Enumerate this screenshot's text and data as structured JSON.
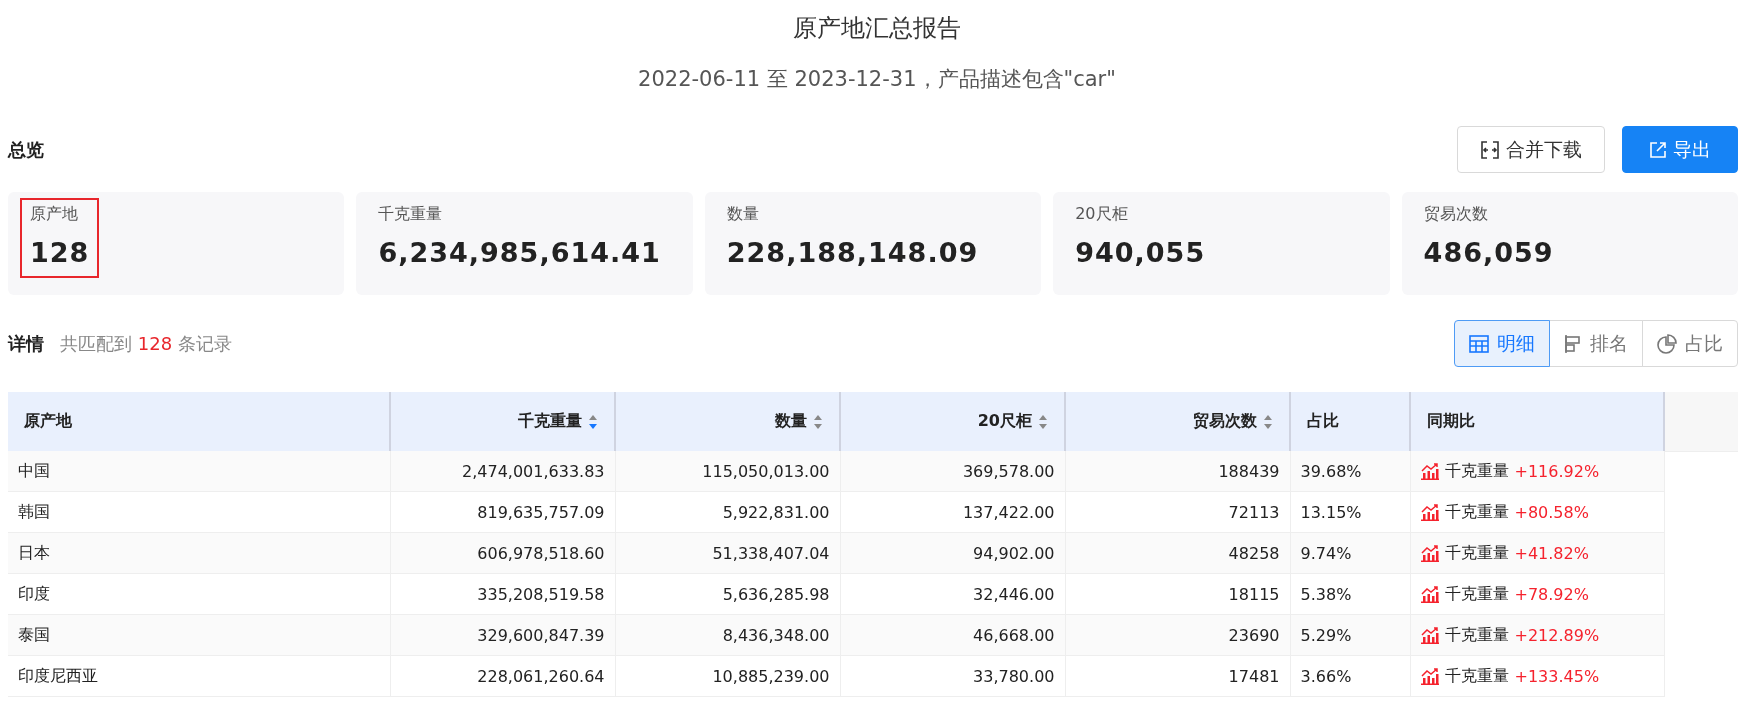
{
  "report": {
    "title": "原产地汇总报告",
    "subtitle": "2022-06-11 至 2023-12-31，产品描述包含\"car\""
  },
  "overview": {
    "heading": "总览",
    "buttons": [
      {
        "label": "合并下载",
        "kind": "merge"
      },
      {
        "label": "导出",
        "kind": "export"
      }
    ],
    "cards": [
      {
        "label": "原产地",
        "value": "128",
        "selected": true
      },
      {
        "label": "千克重量",
        "value": "6,234,985,614.41",
        "selected": false
      },
      {
        "label": "数量",
        "value": "228,188,148.09",
        "selected": false
      },
      {
        "label": "20尺柜",
        "value": "940,055",
        "selected": false
      },
      {
        "label": "贸易次数",
        "value": "486,059",
        "selected": false
      }
    ]
  },
  "details": {
    "heading": "详情",
    "summary_prefix": "共匹配到",
    "count": "128",
    "summary_suffix": "条记录",
    "views": [
      {
        "label": "明细",
        "kind": "table",
        "selected": true
      },
      {
        "label": "排名",
        "kind": "rank",
        "selected": false
      },
      {
        "label": "占比",
        "kind": "pie",
        "selected": false
      }
    ]
  },
  "table": {
    "columns": [
      {
        "label": "原产地"
      },
      {
        "label": "千克重量",
        "sorted": true
      },
      {
        "label": "数量",
        "sorted": false
      },
      {
        "label": "20尺柜",
        "sorted": false
      },
      {
        "label": "贸易次数",
        "sorted": false
      },
      {
        "label": "占比"
      },
      {
        "label": "同期比"
      }
    ],
    "rows": [
      {
        "cells": [
          "中国",
          "2,474,001,633.83",
          "115,050,013.00",
          "369,578.00",
          "188439",
          "39.68%"
        ],
        "yoy_metric": "千克重量",
        "yoy_change": "+116.92%"
      },
      {
        "cells": [
          "韩国",
          "819,635,757.09",
          "5,922,831.00",
          "137,422.00",
          "72113",
          "13.15%"
        ],
        "yoy_metric": "千克重量",
        "yoy_change": "+80.58%"
      },
      {
        "cells": [
          "日本",
          "606,978,518.60",
          "51,338,407.04",
          "94,902.00",
          "48258",
          "9.74%"
        ],
        "yoy_metric": "千克重量",
        "yoy_change": "+41.82%"
      },
      {
        "cells": [
          "印度",
          "335,208,519.58",
          "5,636,285.98",
          "32,446.00",
          "18115",
          "5.38%"
        ],
        "yoy_metric": "千克重量",
        "yoy_change": "+78.92%"
      },
      {
        "cells": [
          "泰国",
          "329,600,847.39",
          "8,436,348.00",
          "46,668.00",
          "23690",
          "5.29%"
        ],
        "yoy_metric": "千克重量",
        "yoy_change": "+212.89%"
      },
      {
        "cells": [
          "印度尼西亚",
          "228,061,260.64",
          "10,885,239.00",
          "33,780.00",
          "17481",
          "3.66%"
        ],
        "yoy_metric": "千克重量",
        "yoy_change": "+133.45%"
      }
    ]
  }
}
